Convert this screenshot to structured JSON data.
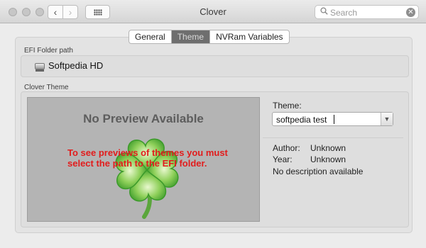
{
  "window": {
    "title": "Clover",
    "back_glyph": "‹",
    "forward_glyph": "›",
    "grid_icon": "grid-icon"
  },
  "search": {
    "placeholder": "Search",
    "value": "",
    "clear_glyph": "✕"
  },
  "tabs": [
    {
      "label": "General",
      "selected": false
    },
    {
      "label": "Theme",
      "selected": true
    },
    {
      "label": "NVRam Variables",
      "selected": false
    }
  ],
  "efi": {
    "section_label": "EFI Folder path",
    "drive_name": "Softpedia HD",
    "drive_icon": "hard-drive-icon"
  },
  "theme_section": {
    "section_label": "Clover Theme",
    "preview_title": "No Preview Available",
    "preview_message": "To see previews of themes you must select the path to the EFI folder.",
    "theme_label": "Theme:",
    "theme_value": "softpedia test",
    "author_label": "Author:",
    "author_value": "Unknown",
    "year_label": "Year:",
    "year_value": "Unknown",
    "description": "No description available"
  },
  "colors": {
    "message_red": "#e21c1c",
    "clover_green": "#5cb83a",
    "tab_selected": "#6e6e6e"
  }
}
